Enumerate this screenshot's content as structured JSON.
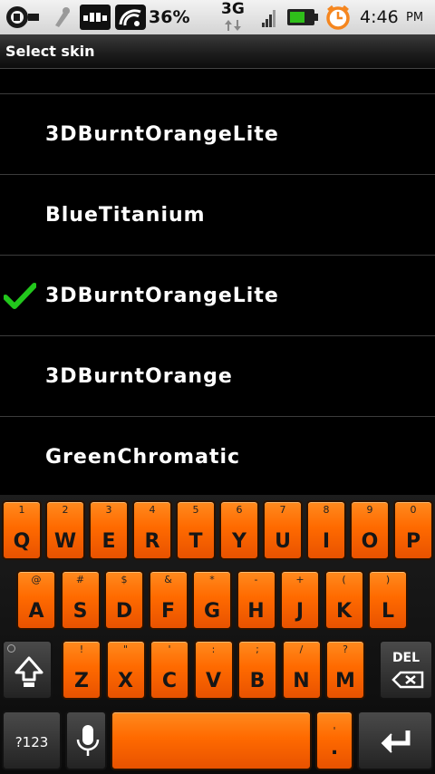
{
  "status_bar": {
    "battery_percent": "36%",
    "network": "3G",
    "time": "4:46",
    "ampm": "PM"
  },
  "title": "Select skin",
  "skins": [
    {
      "label": "3DBurntOrangeLite",
      "selected": false
    },
    {
      "label": "BlueTitanium",
      "selected": false
    },
    {
      "label": "3DBurntOrangeLite",
      "selected": true
    },
    {
      "label": "3DBurntOrange",
      "selected": false
    },
    {
      "label": "GreenChromatic",
      "selected": false
    }
  ],
  "keyboard": {
    "row1": [
      {
        "main": "Q",
        "sub": "1"
      },
      {
        "main": "W",
        "sub": "2"
      },
      {
        "main": "E",
        "sub": "3"
      },
      {
        "main": "R",
        "sub": "4"
      },
      {
        "main": "T",
        "sub": "5"
      },
      {
        "main": "Y",
        "sub": "6"
      },
      {
        "main": "U",
        "sub": "7"
      },
      {
        "main": "I",
        "sub": "8"
      },
      {
        "main": "O",
        "sub": "9"
      },
      {
        "main": "P",
        "sub": "0"
      }
    ],
    "row2": [
      {
        "main": "A",
        "sub": "@"
      },
      {
        "main": "S",
        "sub": "#"
      },
      {
        "main": "D",
        "sub": "$"
      },
      {
        "main": "F",
        "sub": "&"
      },
      {
        "main": "G",
        "sub": "*"
      },
      {
        "main": "H",
        "sub": "-"
      },
      {
        "main": "J",
        "sub": "+"
      },
      {
        "main": "K",
        "sub": "("
      },
      {
        "main": "L",
        "sub": ")"
      }
    ],
    "row3": [
      {
        "main": "Z",
        "sub": "!"
      },
      {
        "main": "X",
        "sub": "\""
      },
      {
        "main": "C",
        "sub": "'"
      },
      {
        "main": "V",
        "sub": ":"
      },
      {
        "main": "B",
        "sub": ";"
      },
      {
        "main": "N",
        "sub": "/"
      },
      {
        "main": "M",
        "sub": "?"
      }
    ],
    "del_label": "DEL",
    "sym_label": "?123",
    "period_sub": "'",
    "period_main": "."
  },
  "colors": {
    "key_orange": "#ff6a00",
    "check_green": "#22c71c",
    "battery_green": "#2fbf1a",
    "alarm_orange": "#f5861f"
  },
  "icons": [
    "usb-debug-icon",
    "signal-transfer-icon",
    "wifi-hotspot-icon",
    "sync-icon",
    "3g-arrows-icon",
    "signal-bars-icon",
    "battery-icon",
    "alarm-clock-icon",
    "check-icon",
    "shift-icon",
    "backspace-icon",
    "mic-icon",
    "enter-icon"
  ]
}
